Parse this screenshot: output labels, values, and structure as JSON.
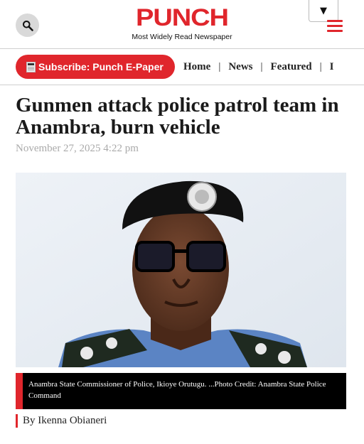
{
  "header": {
    "logo": "PUNCH",
    "tagline": "Most Widely Read Newspaper",
    "language_caret": "▼",
    "brand_color": "#e0262c"
  },
  "nav": {
    "subscribe_label": "Subscribe: Punch E-Paper",
    "links": [
      "Home",
      "News",
      "Featured",
      "I"
    ]
  },
  "article": {
    "headline": "Gunmen attack police patrol team in Anambra, burn vehicle",
    "date": "November 27, 2025 4:22 pm",
    "caption": "Anambra State Commissioner of Police, Ikioye Orutugu. ...Photo Credit: Anambra State Police Command",
    "byline": "By Ikenna Obianeri"
  }
}
